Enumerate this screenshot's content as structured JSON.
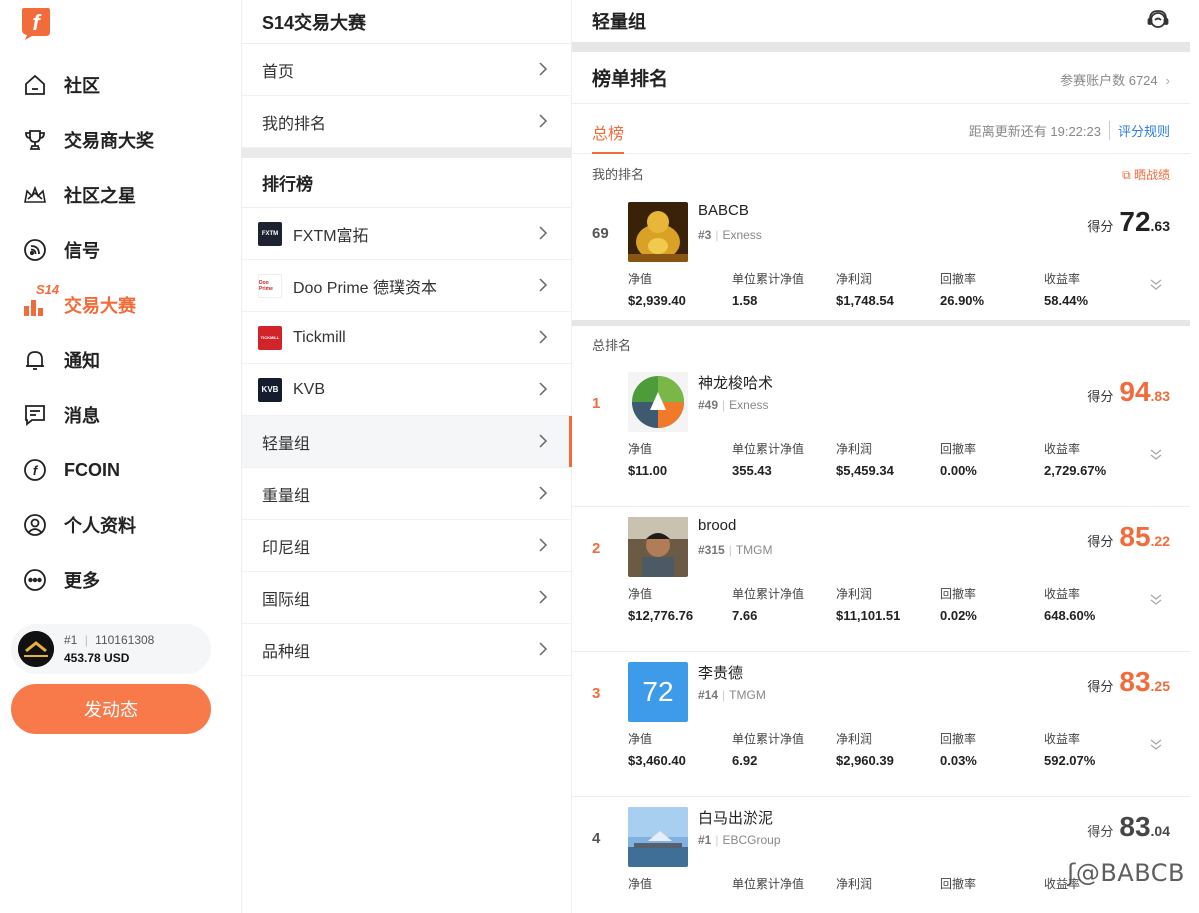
{
  "nav": {
    "items": [
      {
        "label": "社区",
        "icon": "home-icon"
      },
      {
        "label": "交易商大奖",
        "icon": "trophy-icon"
      },
      {
        "label": "社区之星",
        "icon": "crown-icon"
      },
      {
        "label": "信号",
        "icon": "signal-icon"
      },
      {
        "label": "交易大赛",
        "icon": "contest-icon",
        "badge": "S14"
      },
      {
        "label": "通知",
        "icon": "bell-icon"
      },
      {
        "label": "消息",
        "icon": "message-icon"
      },
      {
        "label": "FCOIN",
        "icon": "fcoin-icon"
      },
      {
        "label": "个人资料",
        "icon": "profile-icon"
      },
      {
        "label": "更多",
        "icon": "more-icon"
      }
    ],
    "account": {
      "rank": "#1",
      "id": "110161308",
      "balance": "453.78 USD"
    },
    "post_button": "发动态",
    "accent": "#f26b3a"
  },
  "menu": {
    "title": "S14交易大赛",
    "top_items": [
      "首页",
      "我的排名"
    ],
    "section_title": "排行榜",
    "brokers": [
      {
        "label": "FXTM富拓",
        "logo": "FXTM",
        "color": "#1d2231"
      },
      {
        "label": "Doo Prime 德璞资本",
        "logo": "Doo Prime",
        "color": "#ffffff"
      },
      {
        "label": "Tickmill",
        "logo": "TICKMILL",
        "color": "#d0242a"
      },
      {
        "label": "KVB",
        "logo": "KVB",
        "color": "#141c2e"
      }
    ],
    "groups": [
      "轻量组",
      "重量组",
      "印尼组",
      "国际组",
      "品种组"
    ],
    "active_group": "轻量组"
  },
  "main": {
    "title": "轻量组",
    "rank_title": "榜单排名",
    "participants": "参赛账户数 6724",
    "tab_total": "总榜",
    "countdown": "距离更新还有 19:22:23",
    "rules": "评分规则",
    "my_rank_label": "我的排名",
    "share_label": "晒战绩",
    "overall_label": "总排名",
    "stat_labels": [
      "净值",
      "单位累计净值",
      "净利润",
      "回撤率",
      "收益率"
    ],
    "score_prefix": "得分",
    "my_entry": {
      "rank": "69",
      "name": "BABCB",
      "num": "#3",
      "broker": "Exness",
      "score_int": "72",
      "score_dec": ".63",
      "stats": [
        "$2,939.40",
        "1.58",
        "$1,748.54",
        "26.90%",
        "58.44%"
      ]
    },
    "entries": [
      {
        "rank": "1",
        "name": "神龙梭哈术",
        "num": "#49",
        "broker": "Exness",
        "score_int": "94",
        "score_dec": ".83",
        "stats": [
          "$11.00",
          "355.43",
          "$5,459.34",
          "0.00%",
          "2,729.67%"
        ]
      },
      {
        "rank": "2",
        "name": "brood",
        "num": "#315",
        "broker": "TMGM",
        "score_int": "85",
        "score_dec": ".22",
        "stats": [
          "$12,776.76",
          "7.66",
          "$11,101.51",
          "0.02%",
          "648.60%"
        ]
      },
      {
        "rank": "3",
        "name": "李贵德",
        "num": "#14",
        "broker": "TMGM",
        "score_int": "83",
        "score_dec": ".25",
        "avatar_text": "72",
        "stats": [
          "$3,460.40",
          "6.92",
          "$2,960.39",
          "0.03%",
          "592.07%"
        ]
      },
      {
        "rank": "4",
        "name": "白马出淤泥",
        "num": "#1",
        "broker": "EBCGroup",
        "score_int": "83",
        "score_dec": ".04",
        "stats": [
          "",
          "",
          "",
          "",
          ""
        ]
      }
    ],
    "watermark": "@BABCB"
  }
}
